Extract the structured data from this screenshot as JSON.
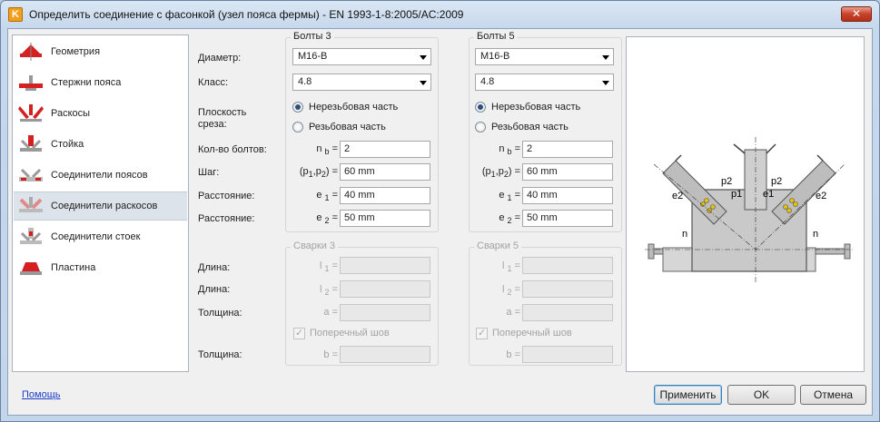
{
  "window": {
    "title": "Определить соединение с фасонкой (узел пояса фермы) - EN 1993-1-8:2005/AC:2009",
    "icon": "K"
  },
  "sidebar": {
    "items": [
      {
        "label": "Геометрия",
        "icon": "geometry-icon"
      },
      {
        "label": "Стержни пояса",
        "icon": "chord-members-icon"
      },
      {
        "label": "Раскосы",
        "icon": "diagonals-icon"
      },
      {
        "label": "Стойка",
        "icon": "post-icon"
      },
      {
        "label": "Соединители поясов",
        "icon": "chord-connectors-icon"
      },
      {
        "label": "Соединители раскосов",
        "icon": "diagonal-connectors-icon",
        "selected": true
      },
      {
        "label": "Соединители стоек",
        "icon": "post-connectors-icon"
      },
      {
        "label": "Пластина",
        "icon": "plate-icon"
      }
    ]
  },
  "labels": {
    "diameter": "Диаметр:",
    "class": "Класс:",
    "shear_plane": "Плоскость среза:",
    "bolt_count": "Кол-во болтов:",
    "pitch": "Шаг:",
    "distance1": "Расстояние:",
    "distance2": "Расстояние:",
    "length1": "Длина:",
    "length2": "Длина:",
    "thickness1": "Толщина:",
    "thickness2": "Толщина:"
  },
  "bolts3": {
    "title": "Болты 3",
    "diameter": "M16-B",
    "class": "4.8",
    "radio_unthreaded": "Нерезьбовая часть",
    "radio_threaded": "Резьбовая часть",
    "selected": "unthreaded",
    "nb_symbol": "n",
    "nb_sub": "b",
    "nb": "2",
    "p_symbol": "(p",
    "p_sub1": "1",
    "p_mid": ",p",
    "p_sub2": "2",
    "p_end": ") =",
    "p": "60 mm",
    "e1_symbol": "e",
    "e1_sub": "1",
    "e1": "40 mm",
    "e2_symbol": "e",
    "e2_sub": "2",
    "e2": "50 mm"
  },
  "bolts5": {
    "title": "Болты 5",
    "diameter": "M16-B",
    "class": "4.8",
    "radio_unthreaded": "Нерезьбовая часть",
    "radio_threaded": "Резьбовая часть",
    "selected": "unthreaded",
    "nb_symbol": "n",
    "nb_sub": "b",
    "nb": "2",
    "p_symbol": "(p",
    "p_sub1": "1",
    "p_mid": ",p",
    "p_sub2": "2",
    "p_end": ") =",
    "p": "60 mm",
    "e1_symbol": "e",
    "e1_sub": "1",
    "e1": "40 mm",
    "e2_symbol": "e",
    "e2_sub": "2",
    "e2": "50 mm"
  },
  "welds3": {
    "title": "Сварки 3",
    "l1_symbol": "l",
    "l1_sub": "1",
    "l2_symbol": "l",
    "l2_sub": "2",
    "a_symbol": "a =",
    "b_symbol": "b =",
    "transverse": "Поперечный шов"
  },
  "welds5": {
    "title": "Сварки 5",
    "l1_symbol": "l",
    "l1_sub": "1",
    "l2_symbol": "l",
    "l2_sub": "2",
    "a_symbol": "a =",
    "b_symbol": "b =",
    "transverse": "Поперечный шов"
  },
  "diagram": {
    "labels": [
      "p2",
      "p1",
      "e1",
      "p2",
      "e2",
      "e2",
      "n",
      "n"
    ]
  },
  "footer": {
    "help": "Помощь",
    "apply": "Применить",
    "ok": "OK",
    "cancel": "Отмена"
  },
  "colors": {
    "icon_red": "#d42020",
    "selected_row": "#dde3ea",
    "link": "#1a3cc8"
  }
}
